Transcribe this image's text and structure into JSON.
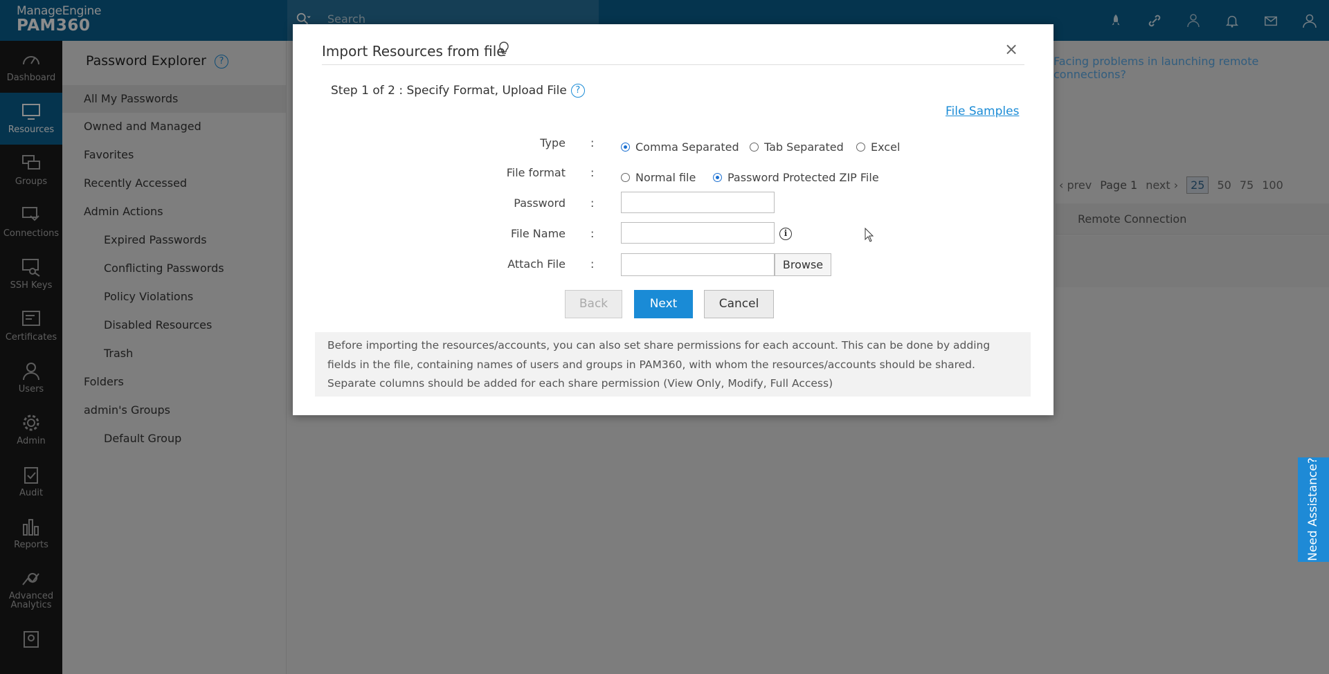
{
  "header": {
    "brand": "ManageEngine",
    "product": "PAM360",
    "search_placeholder": "Search",
    "icons": [
      "rocket-icon",
      "link-icon",
      "star-person-icon",
      "bell-icon",
      "mail-icon",
      "user-icon"
    ]
  },
  "leftnav": {
    "items": [
      {
        "label": "Dashboard",
        "icon": "dashboard-icon"
      },
      {
        "label": "Resources",
        "icon": "monitor-icon",
        "active": true
      },
      {
        "label": "Groups",
        "icon": "groups-icon"
      },
      {
        "label": "Connections",
        "icon": "connections-icon"
      },
      {
        "label": "SSH Keys",
        "icon": "ssh-key-icon"
      },
      {
        "label": "Certificates",
        "icon": "certificate-icon"
      },
      {
        "label": "Users",
        "icon": "users-icon"
      },
      {
        "label": "Admin",
        "icon": "gear-icon"
      },
      {
        "label": "Audit",
        "icon": "audit-icon"
      },
      {
        "label": "Reports",
        "icon": "reports-icon"
      },
      {
        "label": "Advanced",
        "label2": "Analytics",
        "icon": "analytics-icon"
      }
    ]
  },
  "sidepanel": {
    "title": "Password Explorer",
    "items": [
      {
        "label": "All My Passwords"
      },
      {
        "label": "Owned and Managed"
      },
      {
        "label": "Favorites"
      },
      {
        "label": "Recently Accessed"
      },
      {
        "label": "Admin Actions"
      },
      {
        "label": "Expired Passwords"
      },
      {
        "label": "Conflicting Passwords"
      },
      {
        "label": "Policy Violations"
      },
      {
        "label": "Disabled Resources"
      },
      {
        "label": "Trash"
      },
      {
        "label": "Folders"
      },
      {
        "label": "admin's Groups"
      },
      {
        "label": "Default Group"
      }
    ]
  },
  "background": {
    "facing_problems": "Facing problems in launching remote connections?",
    "pager": {
      "prev": "prev",
      "page": "Page 1",
      "next": "next",
      "sizes": [
        "25",
        "50",
        "75",
        "100"
      ],
      "selected_size": "25"
    },
    "column_header": "Remote Connection",
    "need_assistance": "Need Assistance?"
  },
  "modal": {
    "title": "Import Resources from file",
    "close": "×",
    "step": "Step 1 of 2 : Specify Format, Upload File",
    "help": "?",
    "file_samples": "File Samples",
    "colon": ":",
    "type_label": "Type",
    "type_options": [
      {
        "label": "Comma Separated",
        "checked": true
      },
      {
        "label": "Tab Separated",
        "checked": false
      },
      {
        "label": "Excel",
        "checked": false
      }
    ],
    "file_format_label": "File format",
    "file_format_options": [
      {
        "label": "Normal file",
        "checked": false
      },
      {
        "label": "Password Protected ZIP File",
        "checked": true
      }
    ],
    "password_label": "Password",
    "file_name_label": "File Name",
    "attach_file_label": "Attach File",
    "browse": "Browse",
    "info": "i",
    "back": "Back",
    "next": "Next",
    "cancel": "Cancel",
    "note": "Before importing the resources/accounts, you can also set share permissions for each account. This can be done by adding fields in the file, containing names of users and groups in PAM360, with whom the resources/accounts should be shared. Separate columns should be added for each share permission (View Only, Modify, Full Access)"
  },
  "colors": {
    "topbar": "#0a5f8f",
    "accent": "#1a8bd6",
    "nav_bg": "#1b1b1b"
  }
}
